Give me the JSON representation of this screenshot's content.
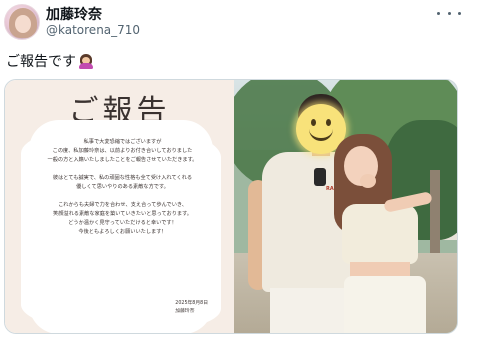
{
  "tweet": {
    "display_name": "加藤玲奈",
    "handle": "@katorena_710",
    "text": "ご報告です",
    "more_icon": "more-horizontal-icon"
  },
  "media": {
    "letter": {
      "title": "ご報告",
      "lines": [
        "私事で大変恐縮ではございますが",
        "この度、私加藤玲奈は、以前よりお付き合いしておりました",
        "一般の方と入籍いたしましたことをご報告させていただきます。",
        "",
        "彼はとても誠実で、私の頑固な性格も全て受け入れてくれる",
        "優しくて思いやりのある素敵な方です。",
        "",
        "これからも夫婦で力を合わせ、支え合って歩んでいき、",
        "笑顔溢れる素敵な家庭を築いていきたいと思っております。",
        "どうか温かく見守っていただけると幸いです！",
        "今後ともよろしくお願いいたします！"
      ],
      "date": "2025年8月8日",
      "signature": "加藤玲奈"
    },
    "photo": {
      "face_cover": "smiley-face-icon",
      "shirt_logo_text": "RAGMA"
    }
  }
}
